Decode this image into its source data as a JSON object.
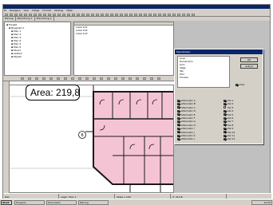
{
  "window": {
    "title": "",
    "menu": [
      "Fil",
      "Redigera",
      "Visa",
      "Infoga",
      "Format",
      "Verktyg",
      "Hjälp"
    ]
  },
  "tabs": [
    "Ritning",
    "Planritning 1",
    "Planritning 2"
  ],
  "tree": {
    "items": [
      "Projekt",
      "Byggnad A",
      "Plan 1",
      "Plan 2",
      "Plan 3",
      "Plan 4",
      "Plan 5",
      "Plan 6",
      "Fasad",
      "Sektion",
      "Objekt"
    ]
  },
  "table": {
    "rows": [
      "Lokal 101",
      "Lokal 102",
      "Lokal 103"
    ]
  },
  "dialog": {
    "title": "Egenskaper",
    "list_items": [
      "Area",
      "Rumsnamn",
      "Golv",
      "Vägg",
      "Tak",
      "Dörr",
      "Fönster"
    ],
    "ok_label": "OK",
    "cancel_label": "Avbryt",
    "check_label": "Visa",
    "left_checks": [
      {
        "label": "Alternativ A",
        "on": true
      },
      {
        "label": "Alternativ B",
        "on": true
      },
      {
        "label": "Alternativ C",
        "on": true
      },
      {
        "label": "Alternativ D",
        "on": true
      },
      {
        "label": "Alternativ E",
        "on": true
      },
      {
        "label": "Alternativ F",
        "on": true
      },
      {
        "label": "Alternativ G",
        "on": true
      },
      {
        "label": "Alternativ H",
        "on": true
      },
      {
        "label": "Alternativ I",
        "on": true
      },
      {
        "label": "Alternativ J",
        "on": true
      },
      {
        "label": "Alternativ K",
        "on": true
      },
      {
        "label": "Alternativ L",
        "on": true
      }
    ],
    "right_checks": [
      {
        "label": "Val 1",
        "on": true
      },
      {
        "label": "Val 2",
        "on": true
      },
      {
        "label": "Val 3",
        "on": false
      },
      {
        "label": "Val 4",
        "on": true
      },
      {
        "label": "Val 5",
        "on": true
      },
      {
        "label": "Val 6",
        "on": true
      },
      {
        "label": "Val 7",
        "on": true
      },
      {
        "label": "Val 8",
        "on": true
      },
      {
        "label": "Val 9",
        "on": true
      },
      {
        "label": "Val 10",
        "on": true
      },
      {
        "label": "Val 11",
        "on": true
      },
      {
        "label": "Val 12",
        "on": true
      }
    ]
  },
  "canvas": {
    "area_label": "Area: 219,8",
    "marker_label": "6"
  },
  "statusbar": {
    "items": [
      "Klar",
      "Lager: Plan 1",
      "Skala 1:100",
      "X: 219,8"
    ]
  },
  "taskbar": {
    "start_label": "Start",
    "tasks": [
      "Program",
      "Dokument",
      "Ritning"
    ],
    "time": "12:00"
  },
  "colors": {
    "room_fill": "#f5c4d4",
    "wall": "#1a1a1a",
    "title_bar": "#0a246a",
    "chrome": "#d4d0c8"
  }
}
